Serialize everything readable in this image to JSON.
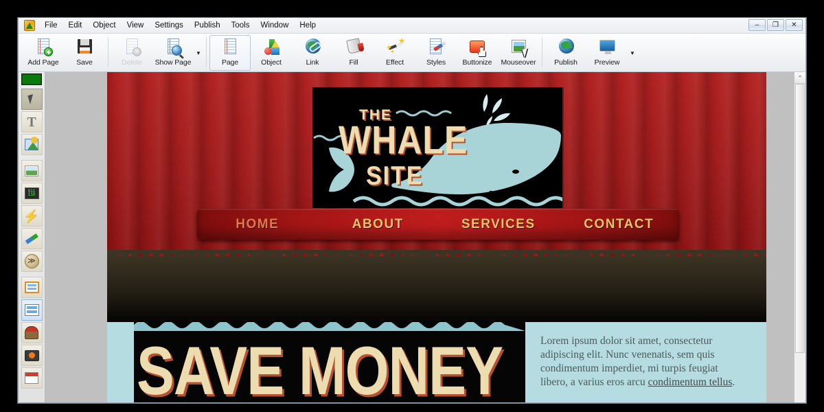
{
  "window": {
    "app_icon": "wysiwyg-web-builder-icon",
    "controls": {
      "minimize": "–",
      "restore": "❐",
      "close": "✕"
    }
  },
  "menubar": {
    "items": [
      "File",
      "Edit",
      "Object",
      "View",
      "Settings",
      "Publish",
      "Tools",
      "Window",
      "Help"
    ]
  },
  "toolbar": {
    "buttons": [
      {
        "label": "Add Page",
        "icon": "page-add-icon",
        "state": "normal"
      },
      {
        "label": "Save",
        "icon": "floppy-disk-icon",
        "state": "normal"
      },
      {
        "label": "Delete",
        "icon": "page-delete-icon",
        "state": "disabled"
      },
      {
        "label": "Show Page",
        "icon": "page-magnifier-icon",
        "state": "normal"
      },
      {
        "label": "Page",
        "icon": "page-icon",
        "state": "selected"
      },
      {
        "label": "Object",
        "icon": "shapes-icon",
        "state": "normal"
      },
      {
        "label": "Link",
        "icon": "globe-link-icon",
        "state": "normal"
      },
      {
        "label": "Fill",
        "icon": "paint-bucket-icon",
        "state": "normal"
      },
      {
        "label": "Effect",
        "icon": "magic-wand-icon",
        "state": "normal"
      },
      {
        "label": "Styles",
        "icon": "page-brush-icon",
        "state": "normal"
      },
      {
        "label": "Buttonize",
        "icon": "button-hand-cursor-icon",
        "state": "normal"
      },
      {
        "label": "Mouseover",
        "icon": "photo-arrow-cursor-icon",
        "state": "normal"
      },
      {
        "label": "Publish",
        "icon": "globe-upload-icon",
        "state": "normal"
      },
      {
        "label": "Preview",
        "icon": "monitor-icon",
        "state": "normal"
      }
    ],
    "caret": "▼"
  },
  "sidebar": {
    "color_swatch": "#0a7a0a",
    "tools": [
      {
        "name": "select-arrow-tool",
        "icon": "arrow-cursor-icon",
        "state": "active"
      },
      {
        "name": "text-tool",
        "icon": "text-T-icon",
        "state": "normal"
      },
      {
        "name": "shape-tool",
        "icon": "shapes-icon",
        "state": "normal"
      },
      {
        "name": "image-tool",
        "icon": "picture-icon",
        "state": "normal"
      },
      {
        "name": "html-code-tool",
        "icon": "code-monitor-icon",
        "state": "normal"
      },
      {
        "name": "action-tool",
        "icon": "lightning-bolt-icon",
        "state": "normal"
      },
      {
        "name": "eyedropper-tool",
        "icon": "pen-dropper-icon",
        "state": "normal"
      },
      {
        "name": "marquee-tool",
        "icon": "disc-chevrons-icon",
        "state": "normal"
      },
      {
        "name": "form-tool",
        "icon": "form-icon",
        "state": "normal"
      },
      {
        "name": "panel-tool",
        "icon": "panel-icon",
        "state": "hover"
      },
      {
        "name": "audio-tool",
        "icon": "jukebox-icon",
        "state": "normal"
      },
      {
        "name": "video-tool",
        "icon": "tv-player-icon",
        "state": "normal"
      },
      {
        "name": "calendar-tool",
        "icon": "calendar-icon",
        "state": "normal"
      }
    ]
  },
  "page": {
    "logo": {
      "line1": "THE",
      "line2": "WHALE",
      "line3": "SITE",
      "illustration": "whale-icon",
      "background": "#000000",
      "text_color": "#ecdcb0",
      "shadow_color": "#b8502f"
    },
    "nav": {
      "items": [
        {
          "label": "HOME",
          "active": true
        },
        {
          "label": "ABOUT",
          "active": false
        },
        {
          "label": "SERVICES",
          "active": false
        },
        {
          "label": "CONTACT",
          "active": false
        }
      ],
      "link_color": "#e8c469",
      "active_color": "#e07a4a"
    },
    "promo": {
      "headline": "SAVE MONEY",
      "background": "#050505",
      "text_color": "#ecdcb0",
      "shadow_color": "#b8502f"
    },
    "copy": {
      "paragraph_before": "Lorem ipsum dolor sit amet, consectetur adipiscing elit. Nunc venenatis, sem quis condimentum imperdiet, mi turpis feugiat libero, a varius eros arcu ",
      "link_text": "condimentum tellus",
      "paragraph_after": "."
    },
    "colors": {
      "curtain_red": "#a01c1c",
      "dark_band": "#241f14",
      "teal_background": "#b5dce0",
      "nav_red": "#a51616"
    }
  },
  "scrollbar": {
    "up_arrow": "⌃"
  }
}
